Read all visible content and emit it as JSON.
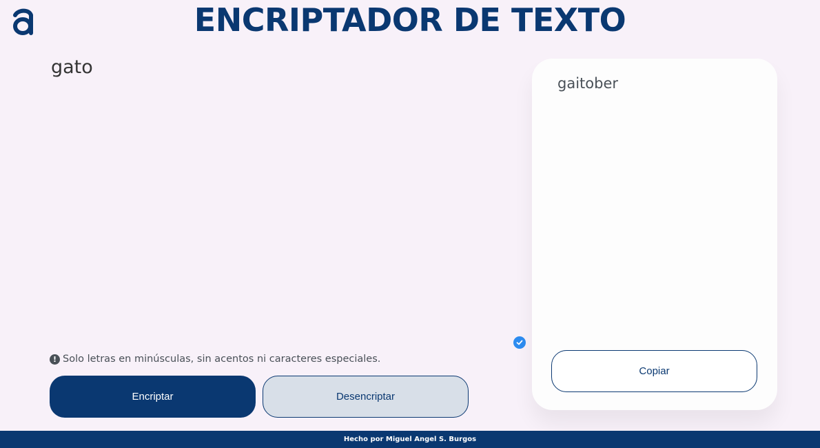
{
  "header": {
    "logo_icon": "alura-logo-icon",
    "title": "ENCRIPTADOR DE TEXTO"
  },
  "input": {
    "value": "gato"
  },
  "hint": {
    "icon": "exclamation-circle-icon",
    "text": "Solo letras en minúsculas, sin acentos ni caracteres especiales."
  },
  "buttons": {
    "encrypt_label": "Encriptar",
    "decrypt_label": "Desencriptar",
    "copy_label": "Copiar"
  },
  "output": {
    "text": "gaitober",
    "badge_icon": "check-circle-icon"
  },
  "footer": {
    "text": "Hecho por Miguel Angel S. Burgos"
  },
  "colors": {
    "background": "#f8f1f9",
    "primary": "#0a3871",
    "secondary_button": "#d8dfe8",
    "card": "#fdfdfd",
    "badge": "#2d8cf0"
  }
}
